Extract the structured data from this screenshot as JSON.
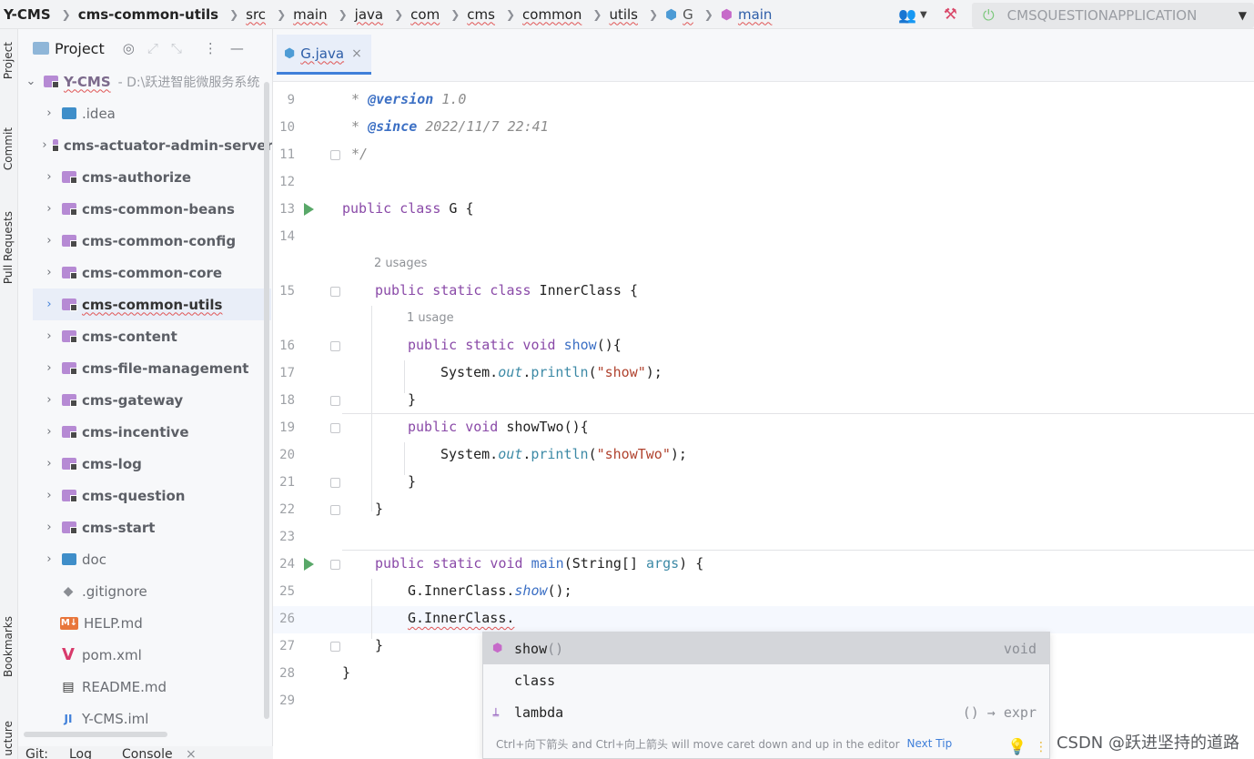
{
  "navbar": {
    "project": "Y-CMS",
    "module": "cms-common-utils",
    "crumbs": [
      "src",
      "main",
      "java",
      "com",
      "cms",
      "common",
      "utils"
    ],
    "class_crumb": "G",
    "method_crumb": "main",
    "run_config": "CMSQUESTIONAPPLICATION"
  },
  "tool_strip": {
    "project": "Project",
    "commit": "Commit",
    "pull_requests": "Pull Requests",
    "bookmarks": "Bookmarks",
    "structure": "ucture"
  },
  "project_panel": {
    "title": "Project",
    "root": {
      "name": "Y-CMS",
      "path": "- D:\\跃进智能微服务系统"
    },
    "items": [
      {
        "name": ".idea",
        "type": "idea"
      },
      {
        "name": "cms-actuator-admin-server",
        "type": "module"
      },
      {
        "name": "cms-authorize",
        "type": "module"
      },
      {
        "name": "cms-common-beans",
        "type": "module"
      },
      {
        "name": "cms-common-config",
        "type": "module"
      },
      {
        "name": "cms-common-core",
        "type": "module"
      },
      {
        "name": "cms-common-utils",
        "type": "module"
      },
      {
        "name": "cms-content",
        "type": "module"
      },
      {
        "name": "cms-file-management",
        "type": "module"
      },
      {
        "name": "cms-gateway",
        "type": "module"
      },
      {
        "name": "cms-incentive",
        "type": "module"
      },
      {
        "name": "cms-log",
        "type": "module"
      },
      {
        "name": "cms-question",
        "type": "module"
      },
      {
        "name": "cms-start",
        "type": "module"
      },
      {
        "name": "doc",
        "type": "doc"
      },
      {
        "name": ".gitignore",
        "type": "gitignore"
      },
      {
        "name": "HELP.md",
        "type": "md"
      },
      {
        "name": "pom.xml",
        "type": "maven"
      },
      {
        "name": "README.md",
        "type": "readme"
      },
      {
        "name": "Y-CMS.iml",
        "type": "iml"
      }
    ]
  },
  "bottom_strip": {
    "git": "Git:",
    "log": "Log",
    "console": "Console"
  },
  "editor": {
    "tab_label": "G.java",
    "line_numbers": [
      "9",
      "10",
      "11",
      "12",
      "13",
      "14",
      "15",
      "16",
      "17",
      "18",
      "19",
      "20",
      "21",
      "22",
      "23",
      "24",
      "25",
      "26",
      "27",
      "28",
      "29"
    ],
    "hints": {
      "usages_2": "2 usages",
      "usage_1": "1 usage"
    },
    "code": {
      "l9_tag": "@version",
      "l9_val": "1.0",
      "l10_tag": "@since",
      "l10_val": "2022/11/7 22:41",
      "l11": "*/",
      "l13_kw": "public class",
      "l13_rest": "G {",
      "l15_kw": "public static class",
      "l15_rest": "InnerClass {",
      "l16_kw": "public static void",
      "l16_fn": "show",
      "l16_rest": "(){",
      "l17_sys": "System.",
      "l17_out": "out",
      "l17_dot": ".",
      "l17_fn": "println",
      "l17_str": "\"show\"",
      "l17_end": ");",
      "l18": "}",
      "l19_kw": "public void",
      "l19_rest": "showTwo(){",
      "l20_sys": "System.",
      "l20_out": "out",
      "l20_dot": ".",
      "l20_fn": "println",
      "l20_str": "\"showTwo\"",
      "l20_end": ");",
      "l21": "}",
      "l22": "}",
      "l24_kw": "public static void",
      "l24_fn": "main",
      "l24_mid": "(String[]",
      "l24_arg": "args",
      "l24_end": ") {",
      "l25_pre": "G.InnerClass.",
      "l25_fn": "show",
      "l25_end": "();",
      "l26": "G.InnerClass.",
      "l27": "}",
      "l28": "}"
    }
  },
  "completion": {
    "items": [
      {
        "label": "show",
        "suffix": "()",
        "type": "void"
      },
      {
        "label": "class",
        "suffix": "",
        "type": ""
      },
      {
        "label": "lambda",
        "suffix": "",
        "type": "() → expr"
      }
    ],
    "footer": "Ctrl+向下箭头 and Ctrl+向上箭头 will move caret down and up in the editor",
    "next_tip": "Next Tip"
  },
  "watermark": "CSDN @跃进坚持的道路",
  "colors": {
    "accent": "#3f7fd9",
    "run": "#59a869",
    "module_folder": "#b68ad4"
  }
}
